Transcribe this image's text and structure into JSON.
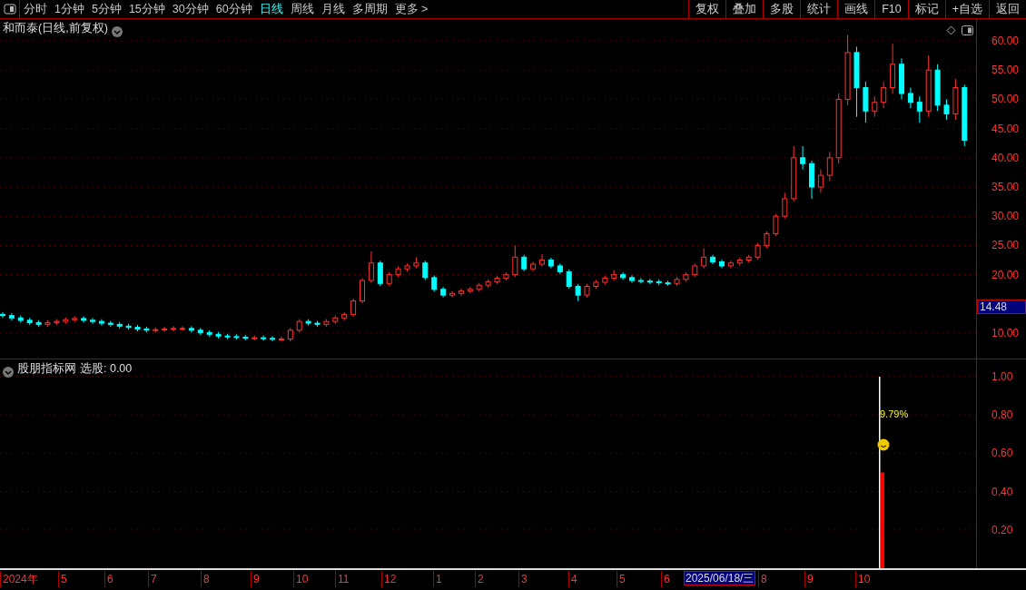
{
  "toolbar": {
    "tabs": [
      {
        "label": "分时",
        "selected": false
      },
      {
        "label": "1分钟",
        "selected": false
      },
      {
        "label": "5分钟",
        "selected": false
      },
      {
        "label": "15分钟",
        "selected": false
      },
      {
        "label": "30分钟",
        "selected": false
      },
      {
        "label": "60分钟",
        "selected": false
      },
      {
        "label": "日线",
        "selected": true
      },
      {
        "label": "周线",
        "selected": false
      },
      {
        "label": "月线",
        "selected": false
      },
      {
        "label": "多周期",
        "selected": false
      },
      {
        "label": "更多 >",
        "selected": false
      }
    ],
    "buttons": [
      "复权",
      "叠加",
      "多股",
      "统计",
      "画线",
      "F10",
      "标记",
      "+自选",
      "返回"
    ]
  },
  "main_chart": {
    "title": "和而泰(日线,前复权)",
    "crosshair_price": "14.48",
    "chart_data": {
      "type": "candlestick",
      "ylim": [
        5.5,
        63.73
      ],
      "yticks": [
        {
          "value": 10,
          "label": "10.00"
        },
        {
          "value": 20,
          "label": "20.00"
        },
        {
          "value": 25,
          "label": "25.00"
        },
        {
          "value": 30,
          "label": "30.00"
        },
        {
          "value": 35,
          "label": "35.00"
        },
        {
          "value": 40,
          "label": "40.00"
        },
        {
          "value": 45,
          "label": "45.00"
        },
        {
          "value": 50,
          "label": "50.00"
        },
        {
          "value": 55,
          "label": "55.00"
        },
        {
          "value": 60,
          "label": "60.00"
        }
      ],
      "grid": true,
      "ohlc": [
        [
          13.2,
          13.6,
          12.6,
          13
        ],
        [
          13,
          13.4,
          12.2,
          12.6
        ],
        [
          12.6,
          13,
          11.8,
          12.2
        ],
        [
          12.2,
          12.6,
          11.4,
          11.8
        ],
        [
          11.8,
          12.2,
          11.1,
          11.5
        ],
        [
          11.5,
          12.2,
          11.1,
          11.8
        ],
        [
          11.8,
          12.4,
          11.4,
          12
        ],
        [
          12,
          12.7,
          11.6,
          12.3
        ],
        [
          12.3,
          12.9,
          11.9,
          12.5
        ],
        [
          12.5,
          12.9,
          11.8,
          12.2
        ],
        [
          12.2,
          12.6,
          11.6,
          12
        ],
        [
          12,
          12.4,
          11.3,
          11.7
        ],
        [
          11.7,
          12.1,
          11.1,
          11.5
        ],
        [
          11.5,
          11.9,
          10.8,
          11.2
        ],
        [
          11.2,
          11.6,
          10.6,
          11
        ],
        [
          11,
          11.4,
          10.3,
          10.7
        ],
        [
          10.7,
          11.1,
          10.1,
          10.5
        ],
        [
          10.5,
          11,
          10.1,
          10.6
        ],
        [
          10.6,
          11.1,
          10.2,
          10.7
        ],
        [
          10.7,
          11.2,
          10.3,
          10.8
        ],
        [
          10.8,
          11.2,
          10.4,
          10.8
        ],
        [
          10.8,
          11.2,
          10.1,
          10.5
        ],
        [
          10.5,
          10.9,
          9.7,
          10.1
        ],
        [
          10.1,
          10.5,
          9.4,
          9.8
        ],
        [
          9.8,
          10.2,
          9.1,
          9.5
        ],
        [
          9.5,
          9.9,
          9,
          9.4
        ],
        [
          9.4,
          9.8,
          8.9,
          9.3
        ],
        [
          9.3,
          9.7,
          8.8,
          9.2
        ],
        [
          9.2,
          9.6,
          8.8,
          9.2
        ],
        [
          9.2,
          9.6,
          8.7,
          9.1
        ],
        [
          9.1,
          9.5,
          8.6,
          9
        ],
        [
          9,
          9.4,
          8.6,
          9
        ],
        [
          9,
          10.9,
          8.6,
          10.5
        ],
        [
          10.5,
          12.4,
          10.1,
          12
        ],
        [
          12,
          12.4,
          11.3,
          11.7
        ],
        [
          11.7,
          12.1,
          11.1,
          11.5
        ],
        [
          11.5,
          12.4,
          11.1,
          12
        ],
        [
          12,
          13,
          11.6,
          12.6
        ],
        [
          12.6,
          13.6,
          12.2,
          13.2
        ],
        [
          13.2,
          15.9,
          12.8,
          15.5
        ],
        [
          15.5,
          19.4,
          15.1,
          19
        ],
        [
          19,
          24,
          18.6,
          22
        ],
        [
          22,
          22.4,
          18.1,
          18.5
        ],
        [
          18.5,
          20.4,
          18.1,
          20
        ],
        [
          20,
          21.4,
          19.6,
          21
        ],
        [
          21,
          21.9,
          20.6,
          21.5
        ],
        [
          21.5,
          23,
          21.1,
          22
        ],
        [
          22,
          22.4,
          19.1,
          19.5
        ],
        [
          19.5,
          19.9,
          17.1,
          17.5
        ],
        [
          17.5,
          17.9,
          16.1,
          16.5
        ],
        [
          16.5,
          17.2,
          16.1,
          16.8
        ],
        [
          16.8,
          17.6,
          16.4,
          17.2
        ],
        [
          17.2,
          17.9,
          16.8,
          17.5
        ],
        [
          17.5,
          18.6,
          17.1,
          18.2
        ],
        [
          18.2,
          19.2,
          17.8,
          18.8
        ],
        [
          18.8,
          19.8,
          18.4,
          19.4
        ],
        [
          19.4,
          20.4,
          19,
          20
        ],
        [
          20,
          25,
          19.6,
          23
        ],
        [
          23,
          23.4,
          20.6,
          21
        ],
        [
          21,
          22.2,
          20.6,
          21.8
        ],
        [
          21.8,
          23.5,
          21.4,
          22.5
        ],
        [
          22.5,
          22.9,
          21.1,
          21.5
        ],
        [
          21.5,
          21.9,
          20.1,
          20.5
        ],
        [
          20.5,
          20.9,
          17.6,
          18
        ],
        [
          18,
          18.4,
          15.5,
          16.5
        ],
        [
          16.5,
          18.4,
          16.1,
          18
        ],
        [
          18,
          19.1,
          17.6,
          18.7
        ],
        [
          18.7,
          19.8,
          18.3,
          19.4
        ],
        [
          19.4,
          20.8,
          19,
          20
        ],
        [
          20,
          20.4,
          19.1,
          19.5
        ],
        [
          19.5,
          19.9,
          18.6,
          19
        ],
        [
          19,
          19.4,
          18.5,
          18.9
        ],
        [
          18.9,
          19.3,
          18.4,
          18.8
        ],
        [
          18.8,
          19.2,
          18.2,
          18.6
        ],
        [
          18.6,
          19,
          18.1,
          18.5
        ],
        [
          18.5,
          19.6,
          18.1,
          19.2
        ],
        [
          19.2,
          20.4,
          18.8,
          20
        ],
        [
          20,
          21.9,
          19.6,
          21.5
        ],
        [
          21.5,
          24.5,
          21.1,
          23
        ],
        [
          23,
          23.4,
          21.8,
          22.2
        ],
        [
          22.2,
          22.6,
          21.1,
          21.5
        ],
        [
          21.5,
          22.4,
          21.1,
          22
        ],
        [
          22,
          22.9,
          21.6,
          22.5
        ],
        [
          22.5,
          23.4,
          22.1,
          23
        ],
        [
          23,
          25.4,
          22.6,
          25
        ],
        [
          25,
          27.4,
          24.6,
          27
        ],
        [
          27,
          30.4,
          26.6,
          30
        ],
        [
          30,
          34,
          29.6,
          33
        ],
        [
          33,
          42,
          32.5,
          40
        ],
        [
          40,
          42,
          38,
          39
        ],
        [
          39,
          39.5,
          33,
          35
        ],
        [
          35,
          38,
          34,
          37
        ],
        [
          37,
          41,
          36,
          40
        ],
        [
          40,
          51,
          39,
          50
        ],
        [
          50,
          61,
          49,
          58
        ],
        [
          58,
          59,
          47,
          52
        ],
        [
          52,
          53,
          46,
          48
        ],
        [
          48,
          50.5,
          47,
          49.5
        ],
        [
          49.5,
          53,
          48.5,
          52
        ],
        [
          52,
          59.5,
          51,
          56
        ],
        [
          56,
          57,
          50,
          51
        ],
        [
          51,
          52,
          48.5,
          49.5
        ],
        [
          49.5,
          50.5,
          46,
          48
        ],
        [
          48,
          57.5,
          47,
          55
        ],
        [
          55,
          56,
          48,
          49
        ],
        [
          49,
          50,
          46.5,
          47.5
        ],
        [
          47.5,
          53.5,
          46.5,
          52
        ],
        [
          52,
          52.5,
          42,
          43
        ]
      ]
    }
  },
  "indicator": {
    "name": "股朋指标网",
    "label": "选股: 0.00",
    "chart_data": {
      "type": "bar",
      "grid": true,
      "ylim": [
        0,
        1.09
      ],
      "yticks": [
        {
          "value": 0.2,
          "label": "0.20"
        },
        {
          "value": 0.4,
          "label": "0.40"
        },
        {
          "value": 0.6,
          "label": "0.60"
        },
        {
          "value": 0.8,
          "label": "0.80"
        },
        {
          "value": 1.0,
          "label": "1.00"
        }
      ],
      "series": [
        {
          "color": "#ffffff",
          "values": [
            1.0
          ]
        },
        {
          "color": "#ff0000",
          "values": [
            0.5
          ]
        }
      ],
      "annotations": [
        "9.79%"
      ]
    }
  },
  "date_axis": {
    "labels": [
      "2024年",
      "5",
      "6",
      "7",
      "8",
      "9",
      "10",
      "11",
      "12",
      "1",
      "2",
      "3",
      "4",
      "5",
      "6",
      "8",
      "9",
      "10"
    ],
    "crosshair_date": "2025/06/18/三"
  }
}
